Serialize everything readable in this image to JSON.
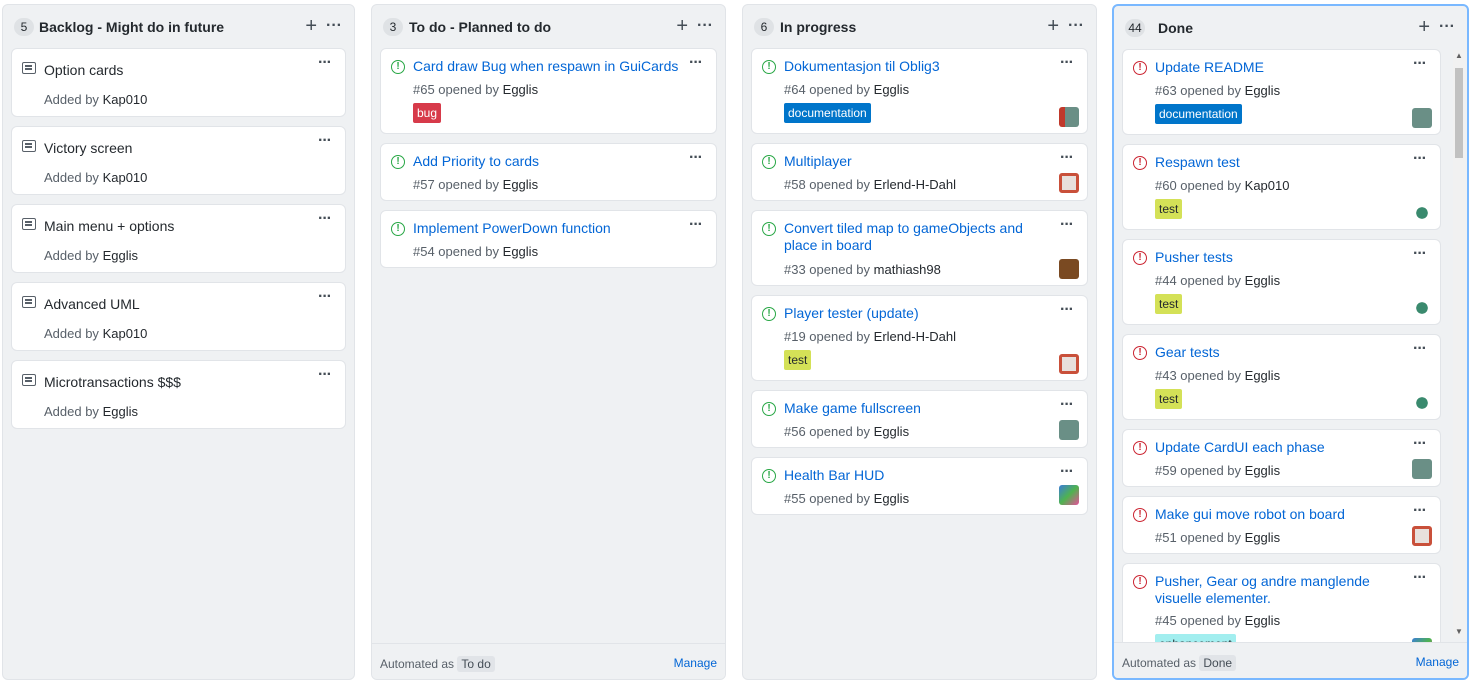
{
  "columns": [
    {
      "count": "5",
      "title": "Backlog - Might do in future",
      "cards": [
        {
          "title": "Option cards",
          "added_prefix": "Added by",
          "author": "Kap010"
        },
        {
          "title": "Victory screen",
          "added_prefix": "Added by",
          "author": "Kap010"
        },
        {
          "title": "Main menu + options",
          "added_prefix": "Added by",
          "author": "Egglis"
        },
        {
          "title": "Advanced UML",
          "added_prefix": "Added by",
          "author": "Kap010"
        },
        {
          "title": "Microtransactions $$$",
          "added_prefix": "Added by",
          "author": "Egglis"
        }
      ]
    },
    {
      "count": "3",
      "title": "To do - Planned to do",
      "cards": [
        {
          "title": "Card draw Bug when respawn in GuiCards",
          "meta": "#65 opened by",
          "author": "Egglis",
          "label": "bug"
        },
        {
          "title": "Add Priority to cards",
          "meta": "#57 opened by",
          "author": "Egglis"
        },
        {
          "title": "Implement PowerDown function",
          "meta": "#54 opened by",
          "author": "Egglis"
        }
      ],
      "footer": {
        "automated": "Automated as",
        "badge": "To do",
        "manage": "Manage"
      }
    },
    {
      "count": "6",
      "title": "In progress",
      "cards": [
        {
          "title": "Dokumentasjon til Oblig3",
          "meta": "#64 opened by",
          "author": "Egglis",
          "label": "documentation"
        },
        {
          "title": "Multiplayer",
          "meta": "#58 opened by",
          "author": "Erlend-H-Dahl"
        },
        {
          "title_line1": "Convert tiled map to gameObjects and",
          "title_line2": "place in board",
          "meta": "#33 opened by",
          "author": "mathiash98"
        },
        {
          "title": "Player tester (update)",
          "meta": "#19 opened by",
          "author": "Erlend-H-Dahl",
          "label": "test"
        },
        {
          "title": "Make game fullscreen",
          "meta": "#56 opened by",
          "author": "Egglis"
        },
        {
          "title": "Health Bar HUD",
          "meta": "#55 opened by",
          "author": "Egglis"
        }
      ]
    },
    {
      "count": "44",
      "title": "Done",
      "cards": [
        {
          "title": "Update README",
          "meta": "#63 opened by",
          "author": "Egglis",
          "label": "documentation"
        },
        {
          "title": "Respawn test",
          "meta": "#60 opened by",
          "author": "Kap010",
          "label": "test"
        },
        {
          "title": "Pusher tests",
          "meta": "#44 opened by",
          "author": "Egglis",
          "label": "test"
        },
        {
          "title": "Gear tests",
          "meta": "#43 opened by",
          "author": "Egglis",
          "label": "test"
        },
        {
          "title": "Update CardUI each phase",
          "meta": "#59 opened by",
          "author": "Egglis"
        },
        {
          "title": "Make gui move robot on board",
          "meta": "#51 opened by",
          "author": "Egglis"
        },
        {
          "title_line1": "Pusher, Gear og andre manglende",
          "title_line2": "visuelle elementer.",
          "meta": "#45 opened by",
          "author": "Egglis",
          "label": "enhancement"
        }
      ],
      "footer": {
        "automated": "Automated as",
        "badge": "Done",
        "manage": "Manage"
      }
    }
  ],
  "colors": {
    "bug": "#d73a4a",
    "documentation": "#0075ca",
    "test": "#d4e157",
    "enhancement": "#a2eeef",
    "open_icon": "#28a745",
    "closed_icon": "#cb2431",
    "link": "#0366d6"
  },
  "icons": {
    "add": "plus-icon",
    "menu": "kebab-icon",
    "note": "note-icon",
    "issue_open": "issue-opened-icon",
    "issue_closed": "issue-closed-icon"
  }
}
